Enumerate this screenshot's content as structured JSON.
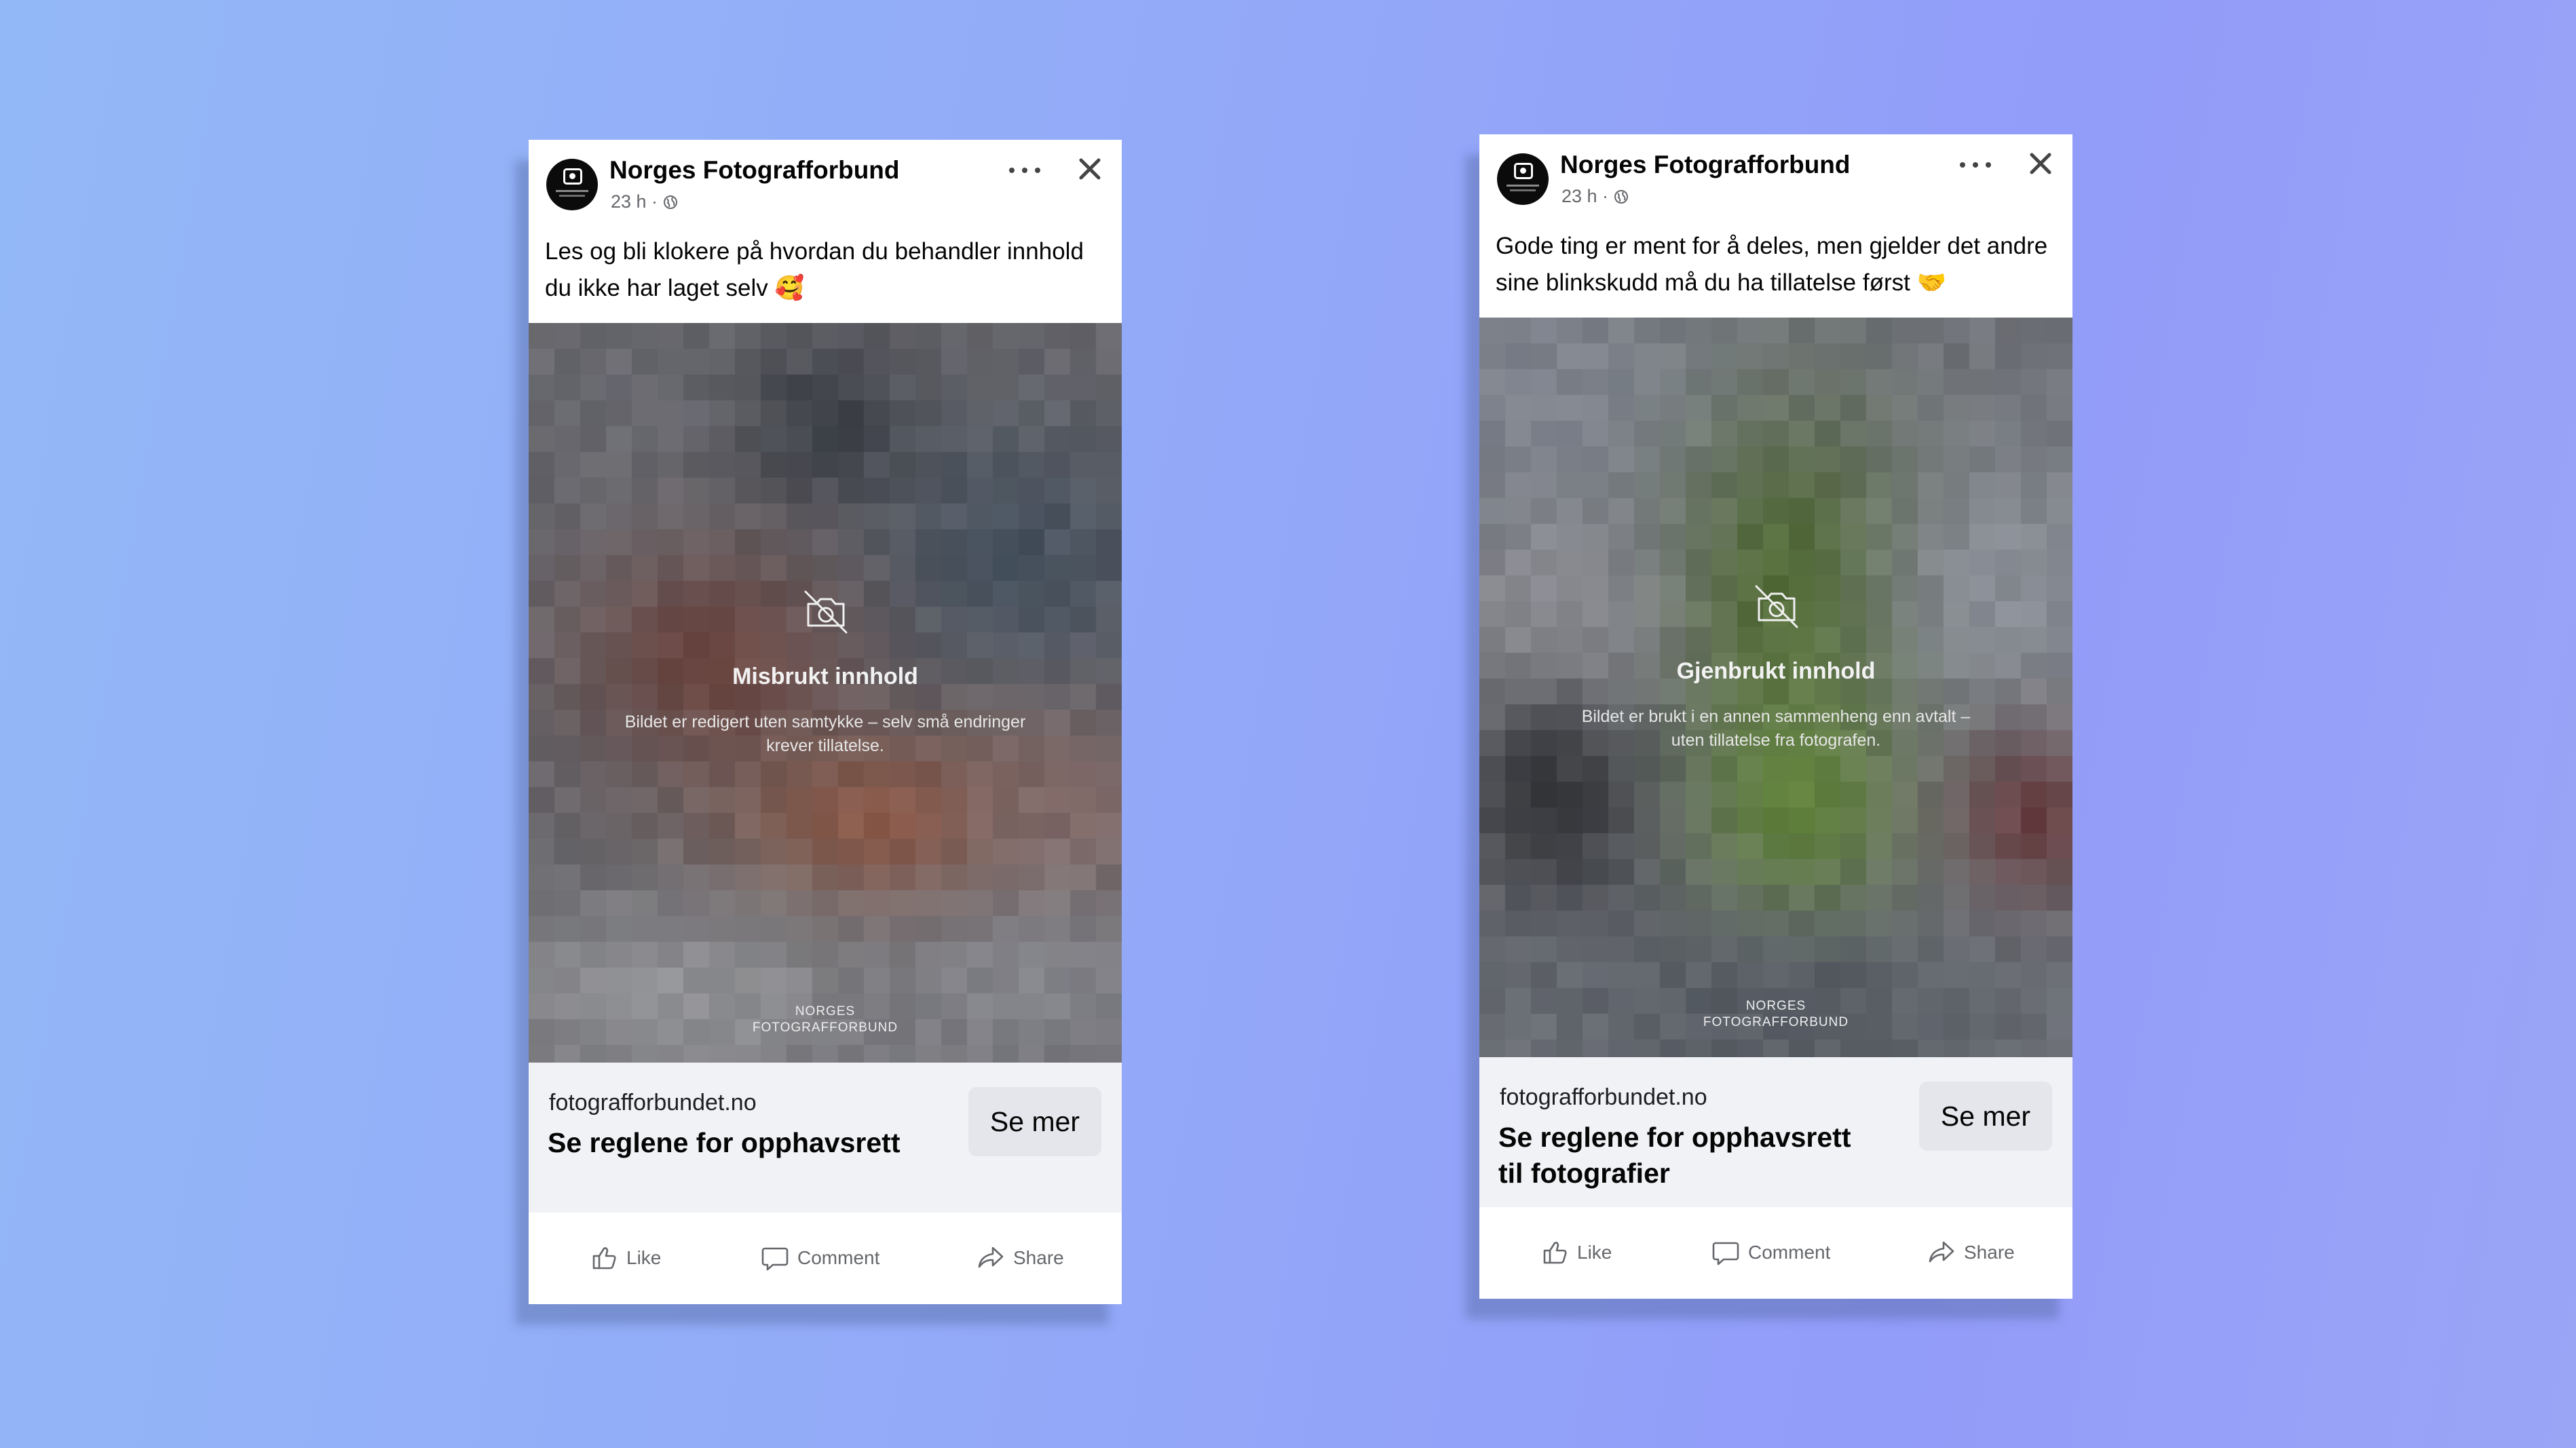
{
  "posts": [
    {
      "page_name": "Norges Fotografforbund",
      "time": "23 h ·",
      "caption": "Les og bli klokere på hvordan du behandler innhold du ikke har laget selv 🥰",
      "media": {
        "title": "Misbrukt innhold",
        "description": "Bildet er redigert uten samtykke – selv små endringer krever tillatelse.",
        "watermark_line1": "NORGES",
        "watermark_line2": "FOTOGRAFFORBUND"
      },
      "link": {
        "domain": "fotografforbundet.no",
        "title": "Se reglene for opphavsrett",
        "button": "Se mer"
      },
      "actions": {
        "like": "Like",
        "comment": "Comment",
        "share": "Share"
      }
    },
    {
      "page_name": "Norges Fotografforbund",
      "time": "23 h ·",
      "caption": "Gode ting er ment for å deles, men gjelder det andre sine blinkskudd må du ha tillatelse først 🤝",
      "media": {
        "title": "Gjenbrukt innhold",
        "description": "Bildet er brukt i en annen sammenheng enn avtalt – uten tillatelse fra fotografen.",
        "watermark_line1": "NORGES",
        "watermark_line2": "FOTOGRAFFORBUND"
      },
      "link": {
        "domain": "fotografforbundet.no",
        "title": "Se reglene for opphavsrett til fotografier",
        "button": "Se mer"
      },
      "actions": {
        "like": "Like",
        "comment": "Comment",
        "share": "Share"
      }
    }
  ],
  "colors": {
    "background_left": "#93b8f7",
    "background_right": "#929cf9",
    "link_box": "#f0f2f5",
    "button": "#e4e6eb",
    "meta_text": "#65676b"
  },
  "icons": [
    "avatar-logo",
    "globe-icon",
    "more-icon",
    "close-icon",
    "camera-off-icon",
    "like-icon",
    "comment-icon",
    "share-icon"
  ]
}
